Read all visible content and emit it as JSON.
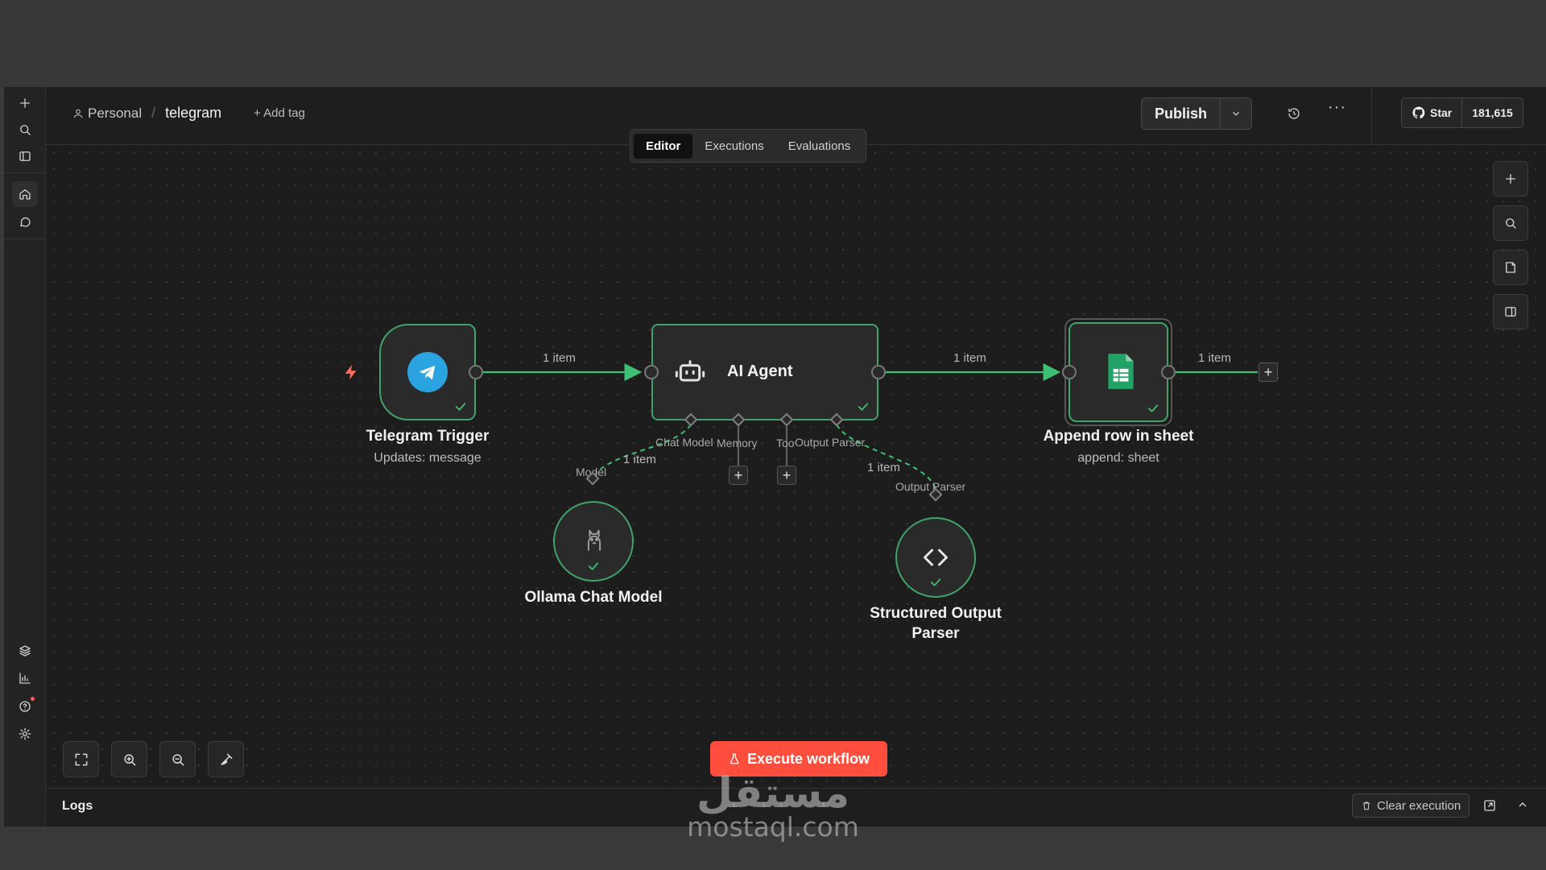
{
  "header": {
    "project": "Personal",
    "workflow_name": "telegram",
    "add_tag": "+ Add tag",
    "tabs": [
      {
        "label": "Editor",
        "active": true
      },
      {
        "label": "Executions",
        "active": false
      },
      {
        "label": "Evaluations",
        "active": false
      }
    ],
    "publish_label": "Publish",
    "star_label": "Star",
    "star_count": "181,615"
  },
  "canvas": {
    "edges": {
      "trigger_to_agent": "1 item",
      "agent_to_sheet": "1 item",
      "sheet_out": "1 item",
      "model_link": "1 item",
      "parser_link": "1 item"
    },
    "agent_ports": {
      "chat_model": "Chat Model",
      "memory": "Memory",
      "tool": "Tool",
      "output_parser": "Output Parser"
    },
    "model_port_label": "Model",
    "parser_port_label": "Output Parser",
    "nodes": {
      "telegram": {
        "title": "Telegram Trigger",
        "subtitle": "Updates: message"
      },
      "agent": {
        "title": "AI Agent"
      },
      "sheet": {
        "title": "Append row in sheet",
        "subtitle": "append: sheet"
      },
      "ollama": {
        "title": "Ollama Chat Model"
      },
      "parser": {
        "title_line1": "Structured Output",
        "title_line2": "Parser"
      }
    },
    "execute_label": "Execute workflow"
  },
  "logs": {
    "label": "Logs",
    "clear_label": "Clear execution"
  },
  "watermark": {
    "arabic": "مستقل",
    "latin": "mostaql.com"
  },
  "colors": {
    "accent_green": "#3fa36a",
    "execute_red": "#ff4e3d",
    "telegram_blue": "#2aa3e0",
    "sheets_green": "#21a366"
  }
}
